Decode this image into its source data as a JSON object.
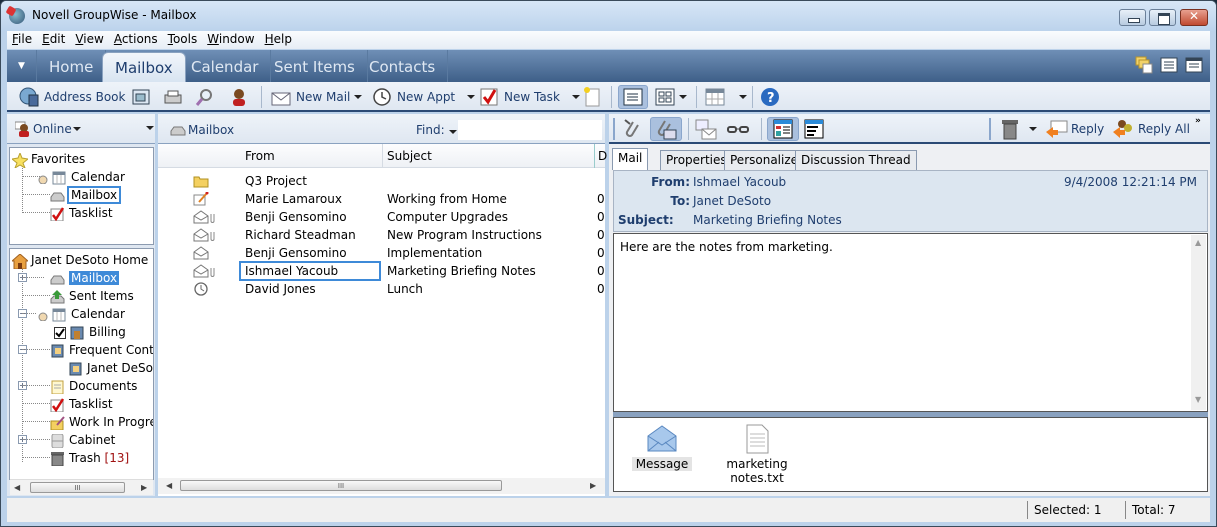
{
  "window": {
    "title": "Novell GroupWise - Mailbox"
  },
  "menu": [
    "File",
    "Edit",
    "View",
    "Actions",
    "Tools",
    "Window",
    "Help"
  ],
  "tabs": [
    {
      "label": "Home",
      "active": false
    },
    {
      "label": "Mailbox",
      "active": true
    },
    {
      "label": "Calendar",
      "active": false
    },
    {
      "label": "Sent Items",
      "active": false
    },
    {
      "label": "Contacts",
      "active": false
    }
  ],
  "toolbar": {
    "address_book": "Address Book",
    "new_mail": "New Mail",
    "new_appt": "New Appt",
    "new_task": "New Task"
  },
  "left": {
    "status": "Online",
    "favorites": {
      "label": "Favorites",
      "items": [
        "Calendar",
        "Mailbox",
        "Tasklist"
      ]
    },
    "home": {
      "label": "Janet DeSoto Home",
      "items": [
        {
          "label": "Mailbox",
          "selected": true
        },
        {
          "label": "Sent Items"
        },
        {
          "label": "Calendar"
        },
        {
          "label": "Billing"
        },
        {
          "label": "Frequent Contacts"
        },
        {
          "label": "Janet DeSoto"
        },
        {
          "label": "Documents"
        },
        {
          "label": "Tasklist"
        },
        {
          "label": "Work In Progress"
        },
        {
          "label": "Cabinet"
        },
        {
          "label": "Trash"
        }
      ],
      "trash_count": "[13]"
    }
  },
  "middle": {
    "folder": "Mailbox",
    "find_label": "Find:",
    "find_value": "",
    "columns": [
      "From",
      "Subject",
      "D"
    ],
    "rows": [
      {
        "icon": "folder",
        "from": "Q3 Project",
        "subject": "",
        "d": ""
      },
      {
        "icon": "note",
        "from": "Marie Lamaroux",
        "subject": "Working from Home",
        "d": "0"
      },
      {
        "icon": "mail-attach",
        "from": "Benji Gensomino",
        "subject": "Computer Upgrades",
        "d": "0"
      },
      {
        "icon": "mail-attach",
        "from": "Richard Steadman",
        "subject": "New Program Instructions",
        "d": "0"
      },
      {
        "icon": "mail",
        "from": "Benji Gensomino",
        "subject": "Implementation",
        "d": "0"
      },
      {
        "icon": "mail-attach",
        "from": "Ishmael Yacoub",
        "subject": "Marketing Briefing Notes",
        "d": "0",
        "selected": true
      },
      {
        "icon": "appointment",
        "from": "David Jones",
        "subject": "Lunch",
        "d": "0"
      }
    ]
  },
  "right": {
    "reply": "Reply",
    "reply_all": "Reply All",
    "tabs": [
      "Mail",
      "Properties",
      "Personalize",
      "Discussion Thread"
    ],
    "from_label": "From:",
    "from": "Ishmael Yacoub",
    "to_label": "To:",
    "to": "Janet DeSoto",
    "subject_label": "Subject:",
    "subject": "Marketing Briefing Notes",
    "date": "9/4/2008 12:21:14 PM",
    "body": "Here are the notes from marketing.",
    "attachments": [
      {
        "label": "Message"
      },
      {
        "label": "marketing notes.txt"
      }
    ]
  },
  "status": {
    "selected": "Selected: 1",
    "total": "Total: 7"
  }
}
